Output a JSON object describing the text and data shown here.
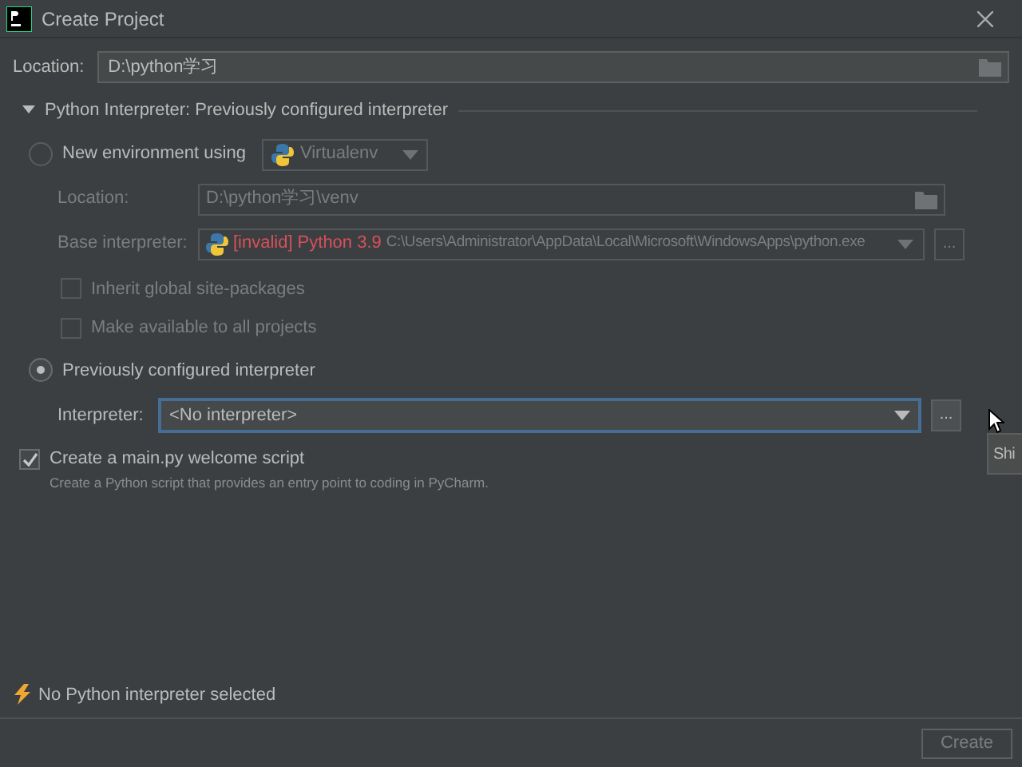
{
  "window": {
    "title": "Create Project"
  },
  "location": {
    "label": "Location:",
    "value": "D:\\python学习"
  },
  "interpreter_section": {
    "title": "Python Interpreter: Previously configured interpreter",
    "expanded": true
  },
  "new_environment": {
    "label": "New environment using",
    "selected": false,
    "tool": "Virtualenv",
    "disabled": true,
    "location_label": "Location:",
    "location_value": "D:\\python学习\\venv",
    "base_label": "Base interpreter:",
    "base_tag": "[invalid]",
    "base_name": "Python 3.9",
    "base_path": "C:\\Users\\Administrator\\AppData\\Local\\Microsoft\\WindowsApps\\python.exe",
    "options": [
      {
        "label": "Inherit global site-packages",
        "checked": false
      },
      {
        "label": "Make available to all projects",
        "checked": false
      }
    ]
  },
  "previous": {
    "label": "Previously configured interpreter",
    "selected": true,
    "interpreter_label": "Interpreter:",
    "interpreter_value": "<No interpreter>",
    "browse": "...",
    "tooltip": "Shi"
  },
  "welcome": {
    "label": "Create a main.py welcome script",
    "checked": true,
    "hint": "Create a Python script that provides an entry point to coding in PyCharm."
  },
  "status": {
    "message": "No Python interpreter selected"
  },
  "create_button": {
    "label": "Create",
    "disabled": true
  }
}
